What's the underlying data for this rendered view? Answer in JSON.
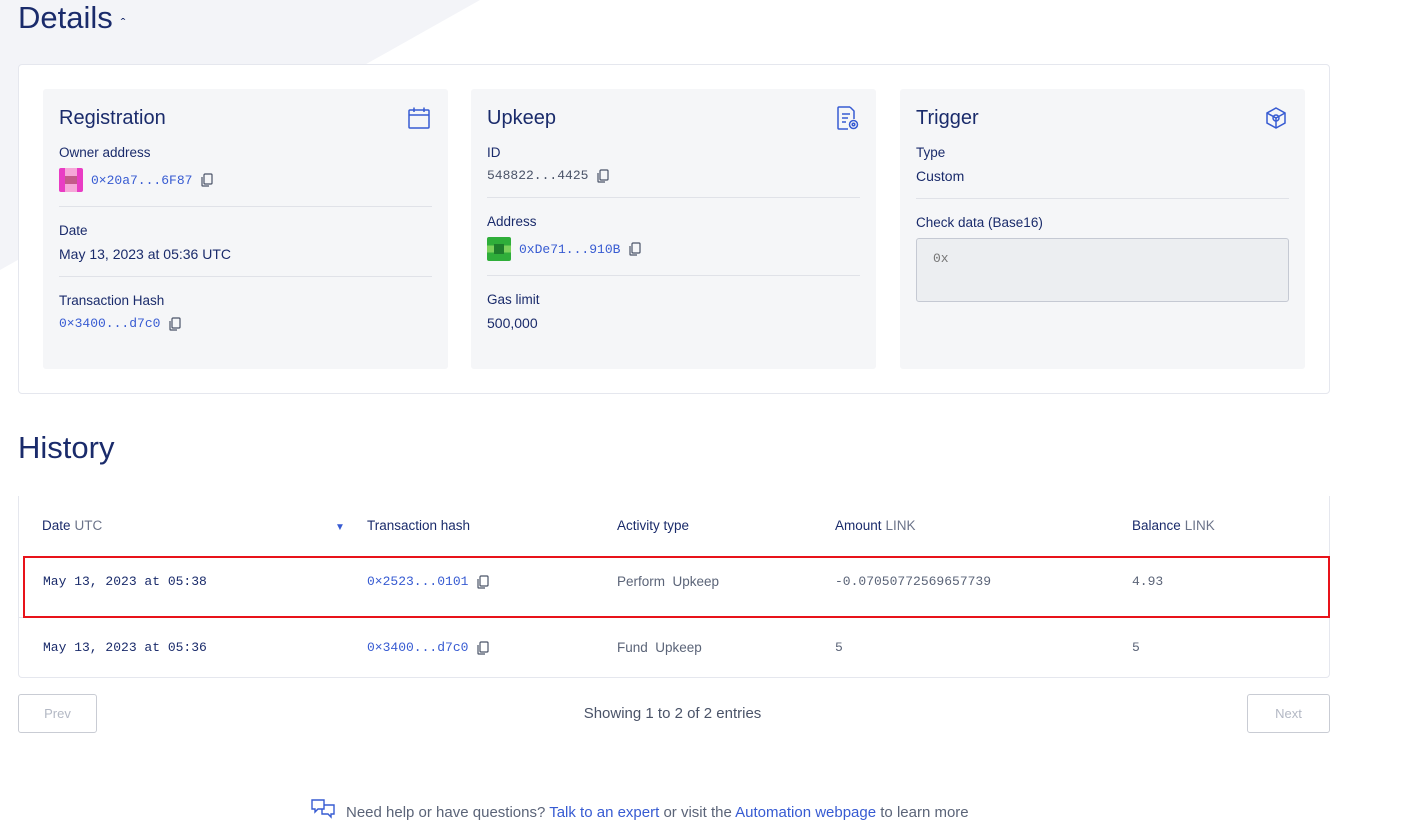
{
  "details": {
    "title": "Details",
    "registration": {
      "title": "Registration",
      "owner_label": "Owner address",
      "owner_value": "0×20a7...6F87",
      "date_label": "Date",
      "date_value": "May 13, 2023 at 05:36 UTC",
      "tx_label": "Transaction Hash",
      "tx_value": "0×3400...d7c0"
    },
    "upkeep": {
      "title": "Upkeep",
      "id_label": "ID",
      "id_value": "548822...4425",
      "address_label": "Address",
      "address_value": "0xDe71...910B",
      "gas_label": "Gas limit",
      "gas_value": "500,000"
    },
    "trigger": {
      "title": "Trigger",
      "type_label": "Type",
      "type_value": "Custom",
      "check_label": "Check data (Base16)",
      "check_placeholder": "0x"
    }
  },
  "history": {
    "title": "History",
    "columns": {
      "date": "Date",
      "date_unit": "UTC",
      "tx": "Transaction hash",
      "activity": "Activity type",
      "amount": "Amount",
      "amount_unit": "LINK",
      "balance": "Balance",
      "balance_unit": "LINK"
    },
    "rows": [
      {
        "date": "May 13, 2023 at 05:38",
        "tx": "0×2523...0101",
        "activity": "Perform  Upkeep",
        "amount": "-0.07050772569657739",
        "balance": "4.93"
      },
      {
        "date": "May 13, 2023 at 05:36",
        "tx": "0×3400...d7c0",
        "activity": "Fund  Upkeep",
        "amount": "5",
        "balance": "5"
      }
    ],
    "prev_label": "Prev",
    "next_label": "Next",
    "showing": "Showing 1 to 2 of 2 entries"
  },
  "help": {
    "prefix": "Need help or have questions?",
    "expert_link": "Talk to an expert",
    "middle": "or visit the",
    "webpage_link": "Automation webpage",
    "suffix": "to learn more"
  },
  "colors": {
    "accent": "#375bd2",
    "heading": "#1a2b6b",
    "highlight": "#e8131a"
  }
}
